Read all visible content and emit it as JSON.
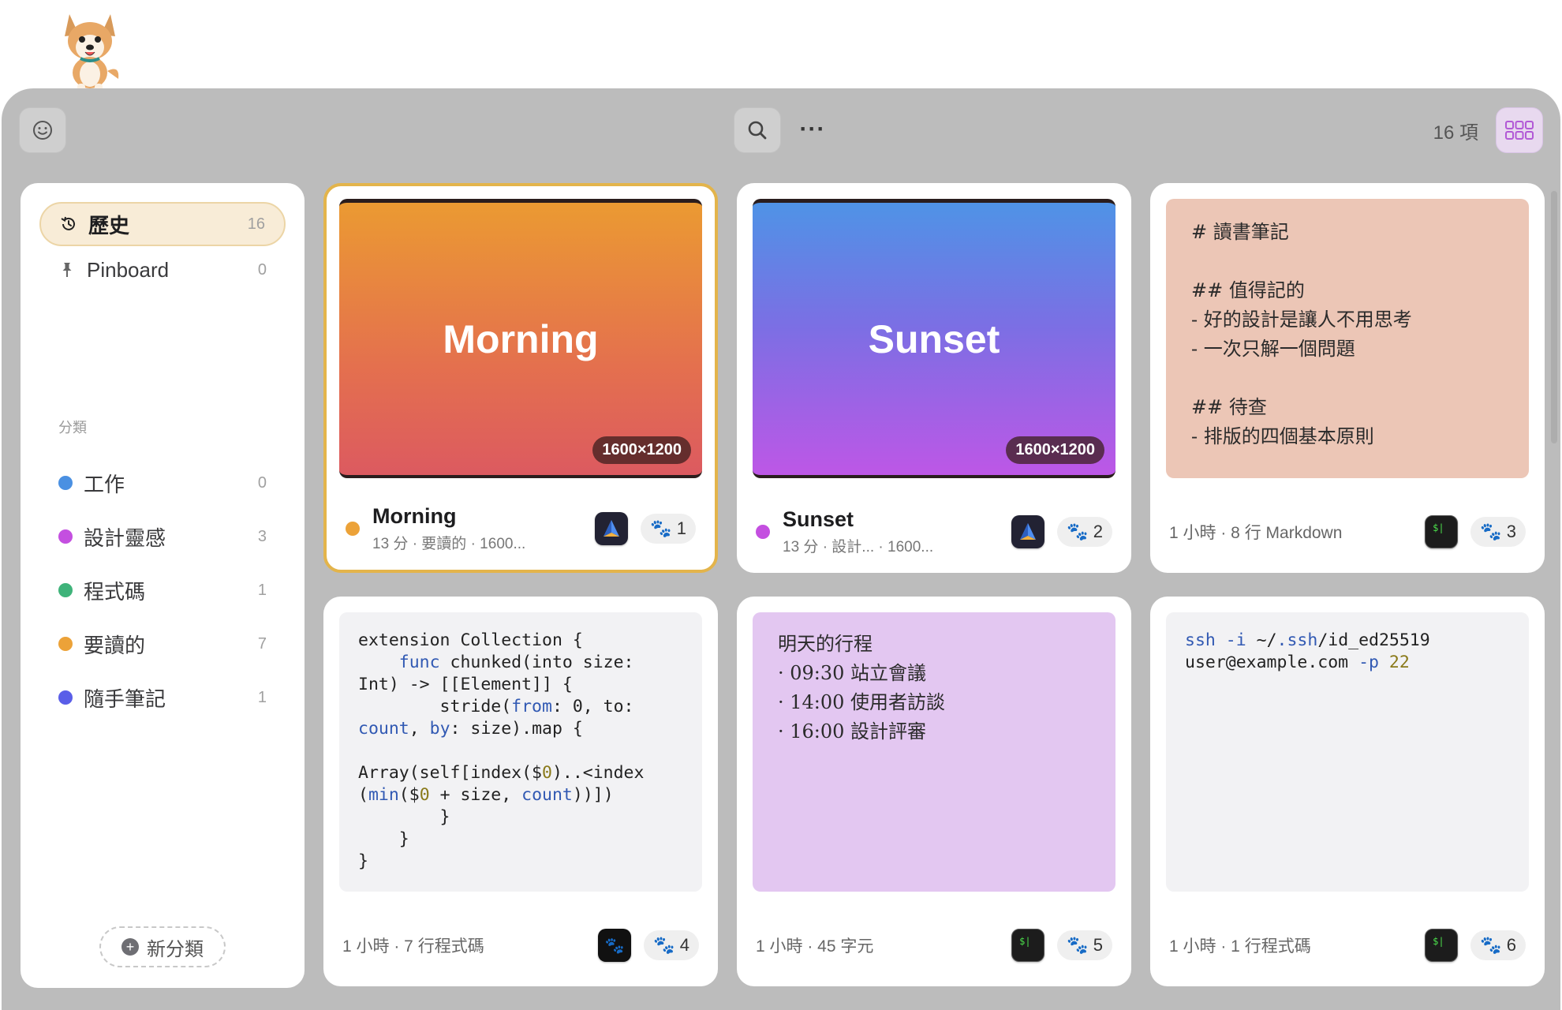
{
  "toolbar": {
    "count_label": "16 項",
    "more_label": "···"
  },
  "sidebar": {
    "history": {
      "label": "歷史",
      "count": "16"
    },
    "pinboard": {
      "label": "Pinboard",
      "count": "0"
    },
    "section_label": "分類",
    "categories": [
      {
        "label": "工作",
        "count": "0",
        "color": "#4a90e2"
      },
      {
        "label": "設計靈感",
        "count": "3",
        "color": "#c44fe0"
      },
      {
        "label": "程式碼",
        "count": "1",
        "color": "#3fb37a"
      },
      {
        "label": "要讀的",
        "count": "7",
        "color": "#eca238"
      },
      {
        "label": "隨手筆記",
        "count": "1",
        "color": "#5a5ee8"
      }
    ],
    "new_category": "新分類"
  },
  "cards": [
    {
      "image_title": "Morning",
      "dims": "1600×1200",
      "title": "Morning",
      "subtitle": "13 分 · 要讀的 · 1600...",
      "dot_color": "#eca238",
      "app_icon": "astro-icon",
      "badge": "1"
    },
    {
      "image_title": "Sunset",
      "dims": "1600×1200",
      "title": "Sunset",
      "subtitle": "13 分 · 設計... · 1600...",
      "dot_color": "#c44fe0",
      "app_icon": "astro-icon",
      "badge": "2"
    },
    {
      "lines": [
        "# 讀書筆記",
        "",
        "## 值得記的",
        "- 好的設計是讓人不用思考",
        "- 一次只解一個問題",
        "",
        "## 待查",
        "- 排版的四個基本原則"
      ],
      "footer": "1 小時 · 8 行 Markdown",
      "app_icon": "terminal-icon",
      "badge": "3"
    },
    {
      "code": "extension Collection {\n    func chunked(into size:\nInt) -> [[Element]] {\n        stride(from: 0, to:\ncount, by: size).map {\n\nArray(self[index($0)..<index\n(min($0 + size, count))])\n        }\n    }\n}",
      "footer": "1 小時 · 7 行程式碼",
      "app_icon": "paw-app-icon",
      "badge": "4"
    },
    {
      "lines": [
        "明天的行程",
        "· 09:30 站立會議",
        "· 14:00 使用者訪談",
        "· 16:00 設計評審"
      ],
      "footer": "1 小時 · 45 字元",
      "app_icon": "terminal-icon",
      "badge": "5"
    },
    {
      "code": "ssh -i ~/.ssh/id_ed25519\nuser@example.com -p 22",
      "footer": "1 小時 · 1 行程式碼",
      "app_icon": "terminal-icon",
      "badge": "6"
    }
  ]
}
